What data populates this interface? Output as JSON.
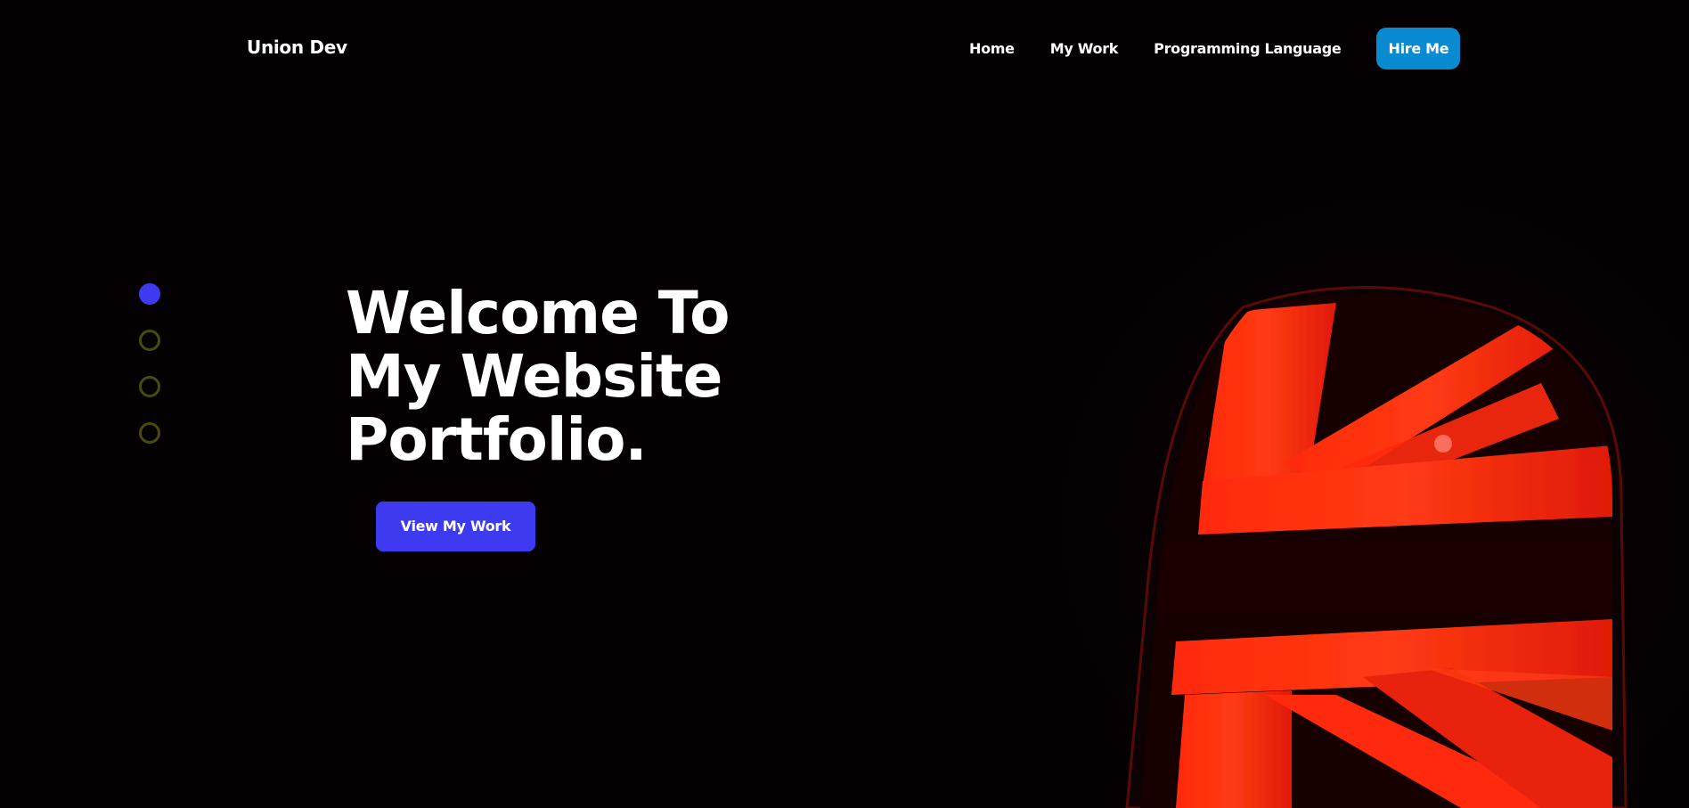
{
  "navbar": {
    "brand": "Union Dev",
    "links": [
      {
        "label": "Home"
      },
      {
        "label": "My Work"
      },
      {
        "label": "Programming Language"
      }
    ],
    "cta_label": "Hire Me"
  },
  "hero": {
    "title_lines": [
      "Welcome To",
      "My Website",
      "Portfolio."
    ],
    "button_label": "View My Work",
    "image": "union-jack-taillight"
  },
  "slider": {
    "dots": [
      {
        "state": "active"
      },
      {
        "state": "inactive"
      },
      {
        "state": "inactive"
      },
      {
        "state": "inactive"
      }
    ]
  },
  "colors": {
    "background": "#050103",
    "accent_blue": "#3e3af0",
    "hire_blue": "#0a8ad0",
    "taillight_red": "#ff2a0a",
    "inactive_dot": "#4a4a10"
  }
}
